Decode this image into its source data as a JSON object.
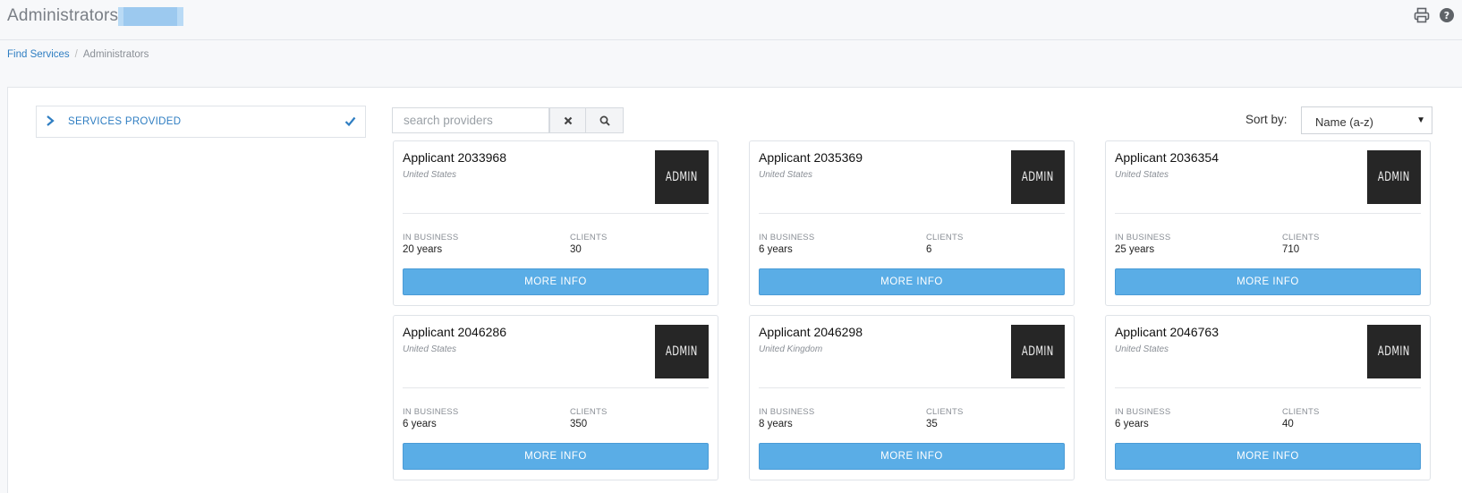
{
  "header": {
    "title": "Administrators",
    "icons": [
      "print-icon",
      "help-icon"
    ]
  },
  "breadcrumb": {
    "items": [
      "Find Services",
      "Administrators"
    ]
  },
  "filter": {
    "label": "SERVICES PROVIDED",
    "icon_left": "chevron-right-icon",
    "icon_right": "checkmark-icon"
  },
  "search": {
    "placeholder": "search providers",
    "value": ""
  },
  "sort": {
    "label": "Sort by:",
    "selected": "Name (a-z)"
  },
  "cards": [
    {
      "name": "Applicant 2033968",
      "country": "United States",
      "logo": "ADMIN",
      "in_business_label": "IN BUSINESS",
      "in_business": "20 years",
      "clients_label": "CLIENTS",
      "clients": "30",
      "button": "MORE INFO"
    },
    {
      "name": "Applicant 2035369",
      "country": "United States",
      "logo": "ADMIN",
      "in_business_label": "IN BUSINESS",
      "in_business": "6 years",
      "clients_label": "CLIENTS",
      "clients": "6",
      "button": "MORE INFO"
    },
    {
      "name": "Applicant 2036354",
      "country": "United States",
      "logo": "ADMIN",
      "in_business_label": "IN BUSINESS",
      "in_business": "25 years",
      "clients_label": "CLIENTS",
      "clients": "710",
      "button": "MORE INFO"
    },
    {
      "name": "Applicant 2046286",
      "country": "United States",
      "logo": "ADMIN",
      "in_business_label": "IN BUSINESS",
      "in_business": "6 years",
      "clients_label": "CLIENTS",
      "clients": "350",
      "button": "MORE INFO"
    },
    {
      "name": "Applicant 2046298",
      "country": "United Kingdom",
      "logo": "ADMIN",
      "in_business_label": "IN BUSINESS",
      "in_business": "8 years",
      "clients_label": "CLIENTS",
      "clients": "35",
      "button": "MORE INFO"
    },
    {
      "name": "Applicant 2046763",
      "country": "United States",
      "logo": "ADMIN",
      "in_business_label": "IN BUSINESS",
      "in_business": "6 years",
      "clients_label": "CLIENTS",
      "clients": "40",
      "button": "MORE INFO"
    }
  ],
  "colors": {
    "accent": "#2f7ec2",
    "button": "#5aade6",
    "logo_bg": "#262626"
  }
}
